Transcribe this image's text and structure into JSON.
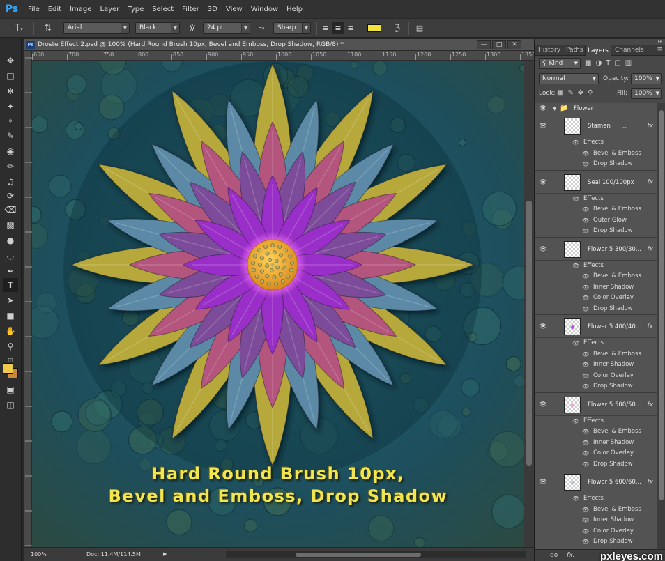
{
  "app": {
    "logo": "Ps"
  },
  "menu": [
    "File",
    "Edit",
    "Image",
    "Layer",
    "Type",
    "Select",
    "Filter",
    "3D",
    "View",
    "Window",
    "Help"
  ],
  "options_bar": {
    "font_family": "Arial",
    "font_style": "Black",
    "font_size": "24 pt",
    "aa_label": "aₐ",
    "anti_alias": "Sharp",
    "text_color": "#f2e23a"
  },
  "document": {
    "title": "Droste Effect 2.psd @ 100% (Hard Round Brush 10px, Bevel and Emboss, Drop Shadow, RGB/8) *",
    "ruler_ticks": [
      "650",
      "700",
      "750",
      "800",
      "850",
      "900",
      "950",
      "1000",
      "1050",
      "1100",
      "1150",
      "1200",
      "1250",
      "1300",
      "1350"
    ],
    "zoom": "100%",
    "doc_info": "Doc: 11.4M/114.5M",
    "caption_line1": "Hard Round Brush 10px,",
    "caption_line2": "Bevel and Emboss, Drop Shadow"
  },
  "panel": {
    "tabs": [
      "History",
      "Paths",
      "Layers",
      "Channels"
    ],
    "active_tab": "Layers",
    "filter_kind": "Kind",
    "blend_mode": "Normal",
    "opacity_label": "Opacity:",
    "opacity": "100%",
    "lock_label": "Lock:",
    "fill_label": "Fill:",
    "fill": "100%",
    "group_name": "Flower",
    "effects_label": "Effects",
    "layers": [
      {
        "name": "Stamen",
        "extra": "...",
        "effects": [
          "Bevel & Emboss",
          "Drop Shadow"
        ]
      },
      {
        "name": "Seal 100/100px",
        "extra": "",
        "effects": [
          "Bevel & Emboss",
          "Outer Glow",
          "Drop Shadow"
        ]
      },
      {
        "name": "Flower 5 300/30...",
        "extra": "",
        "effects": [
          "Bevel & Emboss",
          "Inner Shadow",
          "Color Overlay",
          "Drop Shadow"
        ]
      },
      {
        "name": "Flower 5 400/40...",
        "extra": "",
        "effects": [
          "Bevel & Emboss",
          "Inner Shadow",
          "Color Overlay",
          "Drop Shadow"
        ]
      },
      {
        "name": "Flower 5 500/50...",
        "extra": "",
        "effects": [
          "Bevel & Emboss",
          "Inner Shadow",
          "Color Overlay",
          "Drop Shadow"
        ]
      },
      {
        "name": "Flower 5 600/60...",
        "extra": "",
        "effects": [
          "Bevel & Emboss",
          "Inner Shadow",
          "Color Overlay",
          "Drop Shadow"
        ]
      }
    ],
    "footer_link": "go",
    "footer_fx": "fx."
  },
  "watermark": "pxleyes.com",
  "colors": {
    "foreground": "#f0c84a",
    "background": "#c9893b",
    "petal_gold": "#b7a83a",
    "petal_blue": "#5b8aa6",
    "petal_pink": "#b4547d",
    "petal_purple": "#7c4c9a",
    "petal_violet": "#9a2fc8",
    "stamen": "#e8a332"
  }
}
